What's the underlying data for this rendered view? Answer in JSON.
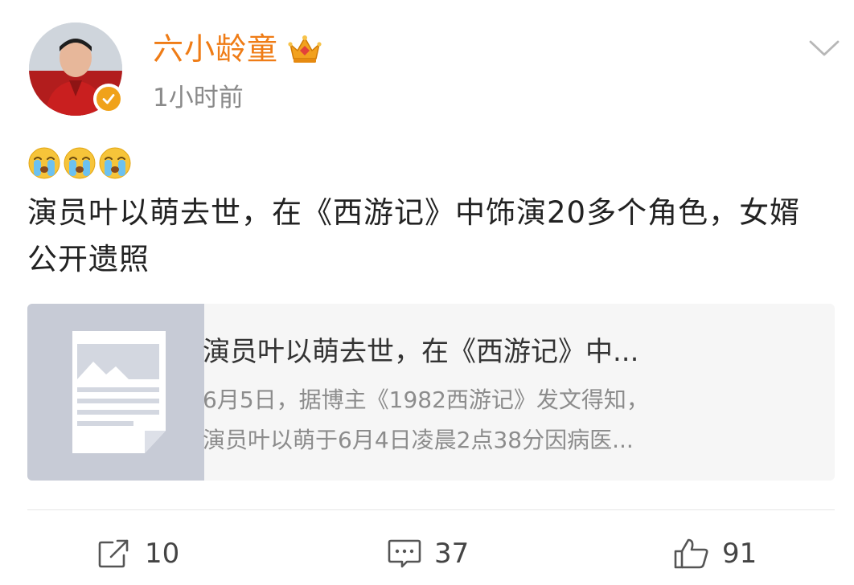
{
  "post": {
    "author": {
      "name": "六小龄童",
      "verified": true,
      "badge_icon": "crown-icon"
    },
    "time": "1小时前",
    "emoji": [
      "cry-emoji",
      "cry-emoji",
      "cry-emoji"
    ],
    "text": "演员叶以萌去世，在《西游记》中饰演20多个角色，女婿公开遗照"
  },
  "link_card": {
    "title": "演员叶以萌去世，在《西游记》中...",
    "desc_line1": "6月5日，据博主《1982西游记》发文得知，",
    "desc_line2": "演员叶以萌于6月4日凌晨2点38分因病医..."
  },
  "actions": {
    "repost_count": "10",
    "comment_count": "37",
    "like_count": "91"
  },
  "colors": {
    "username": "#ef7c16",
    "verified_badge": "#f0a21a",
    "thumb_bg": "#c7cbd6"
  }
}
